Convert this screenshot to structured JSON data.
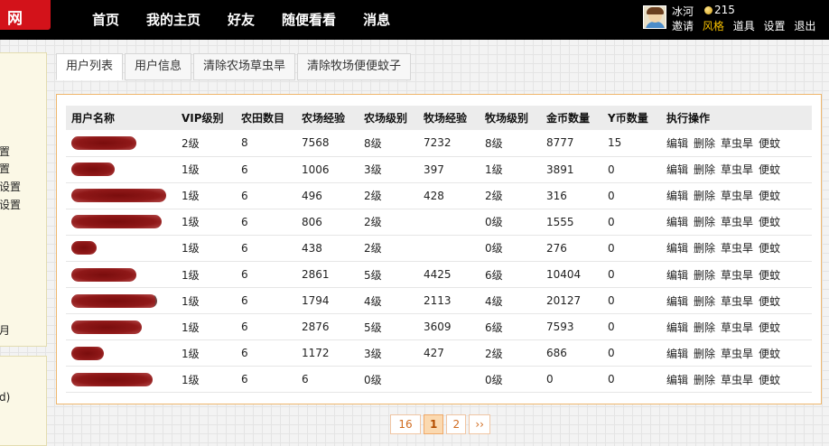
{
  "logo": {
    "text": "网"
  },
  "nav": [
    "首页",
    "我的主页",
    "好友",
    "随便看看",
    "消息"
  ],
  "user": {
    "name": "冰河",
    "coins": "215",
    "links": [
      "邀请",
      "风格",
      "道具",
      "设置",
      "退出"
    ]
  },
  "sidebar": {
    "items": [
      "置",
      "置",
      "设置",
      "设置",
      "月"
    ],
    "bottom_item": "d)"
  },
  "tabs": [
    "用户列表",
    "用户信息",
    "清除农场草虫旱",
    "清除牧场便便蚊子"
  ],
  "table": {
    "headers": [
      "用户名称",
      "VIP级别",
      "农田数目",
      "农场经验",
      "农场级别",
      "牧场经验",
      "牧场级别",
      "金币数量",
      "Y币数量",
      "执行操作"
    ],
    "operations": [
      "编辑",
      "删除",
      "草虫旱",
      "便蚊"
    ],
    "rows": [
      {
        "name_tail": "",
        "vip": "2级",
        "fields": "8",
        "farm_exp": "7568",
        "farm_level": "8级",
        "ranch_exp": "7232",
        "ranch_level": "8级",
        "gold": "8777",
        "ycoin": "15"
      },
      {
        "name_tail": "",
        "vip": "1级",
        "fields": "6",
        "farm_exp": "1006",
        "farm_level": "3级",
        "ranch_exp": "397",
        "ranch_level": "1级",
        "gold": "3891",
        "ycoin": "0"
      },
      {
        "name_tail": "",
        "vip": "1级",
        "fields": "6",
        "farm_exp": "496",
        "farm_level": "2级",
        "ranch_exp": "428",
        "ranch_level": "2级",
        "gold": "316",
        "ycoin": "0"
      },
      {
        "name_tail": "",
        "vip": "1级",
        "fields": "6",
        "farm_exp": "806",
        "farm_level": "2级",
        "ranch_exp": "",
        "ranch_level": "0级",
        "gold": "1555",
        "ycoin": "0"
      },
      {
        "name_tail": "",
        "vip": "1级",
        "fields": "6",
        "farm_exp": "438",
        "farm_level": "2级",
        "ranch_exp": "",
        "ranch_level": "0级",
        "gold": "276",
        "ycoin": "0"
      },
      {
        "name_tail": "",
        "vip": "1级",
        "fields": "6",
        "farm_exp": "2861",
        "farm_level": "5级",
        "ranch_exp": "4425",
        "ranch_level": "6级",
        "gold": "10404",
        "ycoin": "0"
      },
      {
        "name_tail": ")",
        "vip": "1级",
        "fields": "6",
        "farm_exp": "1794",
        "farm_level": "4级",
        "ranch_exp": "2113",
        "ranch_level": "4级",
        "gold": "20127",
        "ycoin": "0"
      },
      {
        "name_tail": "",
        "vip": "1级",
        "fields": "6",
        "farm_exp": "2876",
        "farm_level": "5级",
        "ranch_exp": "3609",
        "ranch_level": "6级",
        "gold": "7593",
        "ycoin": "0"
      },
      {
        "name_tail": "",
        "vip": "1级",
        "fields": "6",
        "farm_exp": "1172",
        "farm_level": "3级",
        "ranch_exp": "427",
        "ranch_level": "2级",
        "gold": "686",
        "ycoin": "0"
      },
      {
        "name_tail": "",
        "vip": "1级",
        "fields": "6",
        "farm_exp": "6",
        "farm_level": "0级",
        "ranch_exp": "",
        "ranch_level": "0级",
        "gold": "0",
        "ycoin": "0"
      }
    ]
  },
  "pagination": {
    "items": [
      "16",
      "1",
      "2",
      "››"
    ],
    "current": "1"
  }
}
